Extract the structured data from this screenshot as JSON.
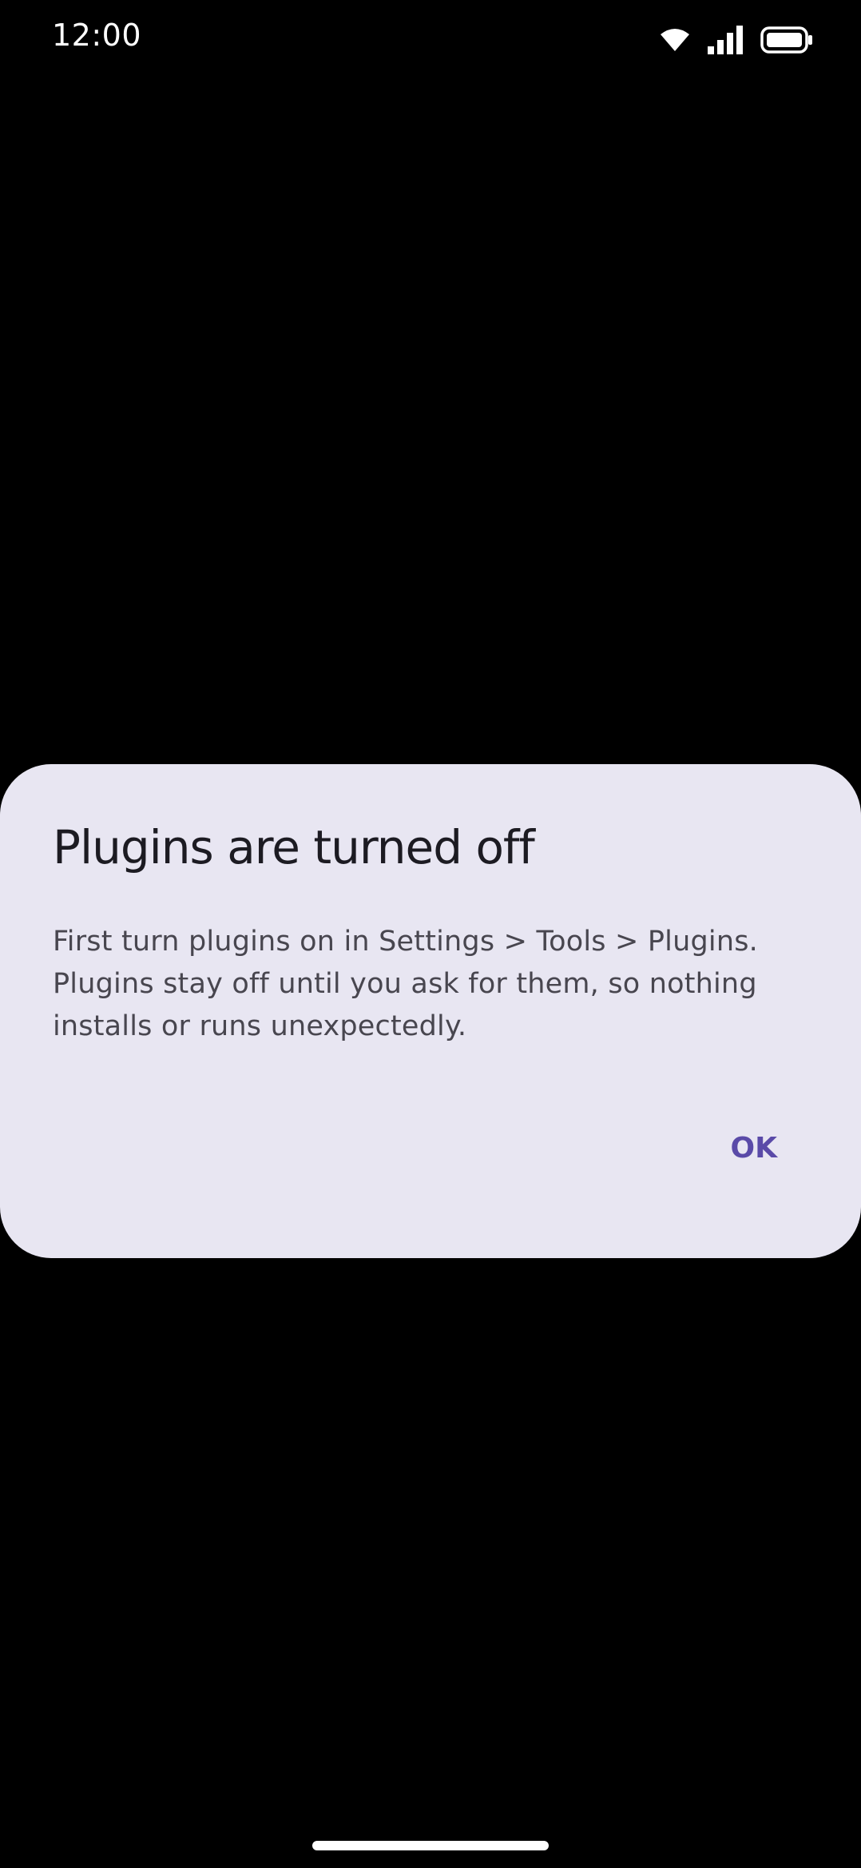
{
  "status_bar": {
    "time": "12:00",
    "icons": [
      "wifi-icon",
      "cellular-signal-icon",
      "battery-icon"
    ]
  },
  "dialog": {
    "title": "Plugins are turned off",
    "body_lines": [
      "First turn plugins on in Settings > Tools > Plugins.",
      "Plugins stay off until you ask for them, so nothing",
      "installs or runs unexpectedly."
    ],
    "ok_label": "OK"
  },
  "colors": {
    "background": "#000000",
    "dialog_surface": "#e8e6f2",
    "title_text": "#1c1b22",
    "body_text": "#48464f",
    "accent": "#5a4aa8"
  }
}
